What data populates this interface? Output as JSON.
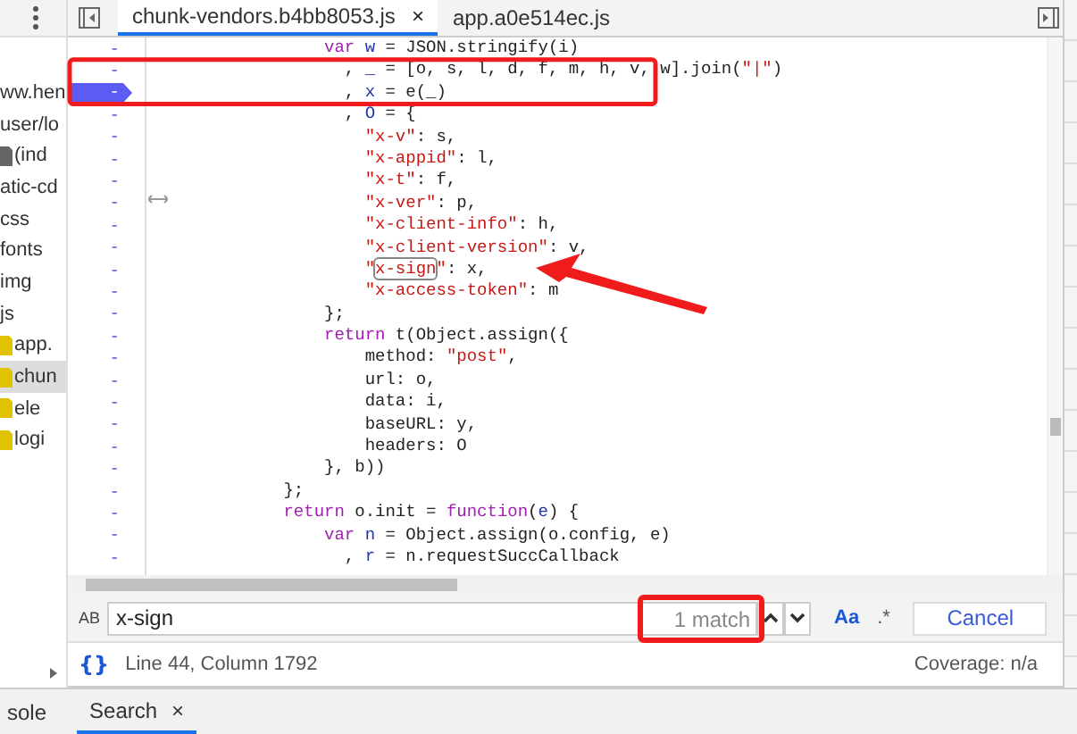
{
  "sidebar": {
    "items": [
      {
        "label": "ww.hen",
        "kind": "folder",
        "selected": false
      },
      {
        "label": "user/lo",
        "kind": "folder",
        "selected": false
      },
      {
        "label": "(ind",
        "kind": "file",
        "selected": false
      },
      {
        "label": "atic-cd",
        "kind": "folder",
        "selected": false
      },
      {
        "label": "css",
        "kind": "folder",
        "selected": false
      },
      {
        "label": "fonts",
        "kind": "folder",
        "selected": false
      },
      {
        "label": "img",
        "kind": "folder",
        "selected": false
      },
      {
        "label": "js",
        "kind": "folder",
        "selected": false
      },
      {
        "label": "app.",
        "kind": "script",
        "selected": false
      },
      {
        "label": "chun",
        "kind": "script",
        "selected": true
      },
      {
        "label": "ele",
        "kind": "script",
        "selected": false
      },
      {
        "label": "logi",
        "kind": "script",
        "selected": false
      }
    ]
  },
  "tabs": [
    {
      "label": "chunk-vendors.b4bb8053.js",
      "selected": true,
      "close": "×"
    },
    {
      "label": "app.a0e514ec.js",
      "selected": false
    }
  ],
  "code": {
    "lines": [
      {
        "mark": "-",
        "breakpoint": false,
        "tokens": [
          {
            "kind": "keyword",
            "text": "               var"
          },
          {
            "kind": "def",
            "text": " w"
          },
          {
            "kind": "plain",
            "text": " = JSON.stringify(i)"
          }
        ]
      },
      {
        "mark": "-",
        "breakpoint": false,
        "tokens": [
          {
            "kind": "plain",
            "text": "                 , "
          },
          {
            "kind": "def",
            "text": "_"
          },
          {
            "kind": "plain",
            "text": " = [o, s, l, d, f, m, h, v, w].join("
          },
          {
            "kind": "string",
            "text": "\"|\""
          },
          {
            "kind": "plain",
            "text": ")"
          }
        ]
      },
      {
        "mark": "-",
        "breakpoint": true,
        "tokens": [
          {
            "kind": "plain",
            "text": "                 , "
          },
          {
            "kind": "def",
            "text": "x"
          },
          {
            "kind": "plain",
            "text": " = e(_)"
          }
        ]
      },
      {
        "mark": "-",
        "breakpoint": false,
        "tokens": [
          {
            "kind": "plain",
            "text": "                 , "
          },
          {
            "kind": "def",
            "text": "O"
          },
          {
            "kind": "plain",
            "text": " = {"
          }
        ]
      },
      {
        "mark": "-",
        "breakpoint": false,
        "tokens": [
          {
            "kind": "string",
            "text": "                   \"x-v\""
          },
          {
            "kind": "plain",
            "text": ": s,"
          }
        ]
      },
      {
        "mark": "-",
        "breakpoint": false,
        "tokens": [
          {
            "kind": "string",
            "text": "                   \"x-appid\""
          },
          {
            "kind": "plain",
            "text": ": l,"
          }
        ]
      },
      {
        "mark": "-",
        "breakpoint": false,
        "tokens": [
          {
            "kind": "string",
            "text": "                   \"x-t\""
          },
          {
            "kind": "plain",
            "text": ": f,"
          }
        ]
      },
      {
        "mark": "-",
        "breakpoint": false,
        "tokens": [
          {
            "kind": "string",
            "text": "                   \"x-ver\""
          },
          {
            "kind": "plain",
            "text": ": p,"
          }
        ]
      },
      {
        "mark": "-",
        "breakpoint": false,
        "tokens": [
          {
            "kind": "string",
            "text": "                   \"x-client-info\""
          },
          {
            "kind": "plain",
            "text": ": h,"
          }
        ]
      },
      {
        "mark": "-",
        "breakpoint": false,
        "tokens": [
          {
            "kind": "string",
            "text": "                   \"x-client-version\""
          },
          {
            "kind": "plain",
            "text": ": v,"
          }
        ]
      },
      {
        "mark": "-",
        "breakpoint": false,
        "tokens": [
          {
            "kind": "string",
            "text": "                   \""
          },
          {
            "kind": "match",
            "text": "x-sign"
          },
          {
            "kind": "string",
            "text": "\""
          },
          {
            "kind": "plain",
            "text": ": x,"
          }
        ]
      },
      {
        "mark": "-",
        "breakpoint": false,
        "tokens": [
          {
            "kind": "string",
            "text": "                   \"x-access-token\""
          },
          {
            "kind": "plain",
            "text": ": m"
          }
        ]
      },
      {
        "mark": "-",
        "breakpoint": false,
        "tokens": [
          {
            "kind": "plain",
            "text": "               };"
          }
        ]
      },
      {
        "mark": "-",
        "breakpoint": false,
        "tokens": [
          {
            "kind": "keyword",
            "text": "               return"
          },
          {
            "kind": "plain",
            "text": " t(Object.assign({"
          }
        ]
      },
      {
        "mark": "-",
        "breakpoint": false,
        "tokens": [
          {
            "kind": "plain",
            "text": "                   method: "
          },
          {
            "kind": "string",
            "text": "\"post\""
          },
          {
            "kind": "plain",
            "text": ","
          }
        ]
      },
      {
        "mark": "-",
        "breakpoint": false,
        "tokens": [
          {
            "kind": "plain",
            "text": "                   url: o,"
          }
        ]
      },
      {
        "mark": "-",
        "breakpoint": false,
        "tokens": [
          {
            "kind": "plain",
            "text": "                   data: i,"
          }
        ]
      },
      {
        "mark": "-",
        "breakpoint": false,
        "tokens": [
          {
            "kind": "plain",
            "text": "                   baseURL: y,"
          }
        ]
      },
      {
        "mark": "-",
        "breakpoint": false,
        "tokens": [
          {
            "kind": "plain",
            "text": "                   headers: O"
          }
        ]
      },
      {
        "mark": "-",
        "breakpoint": false,
        "tokens": [
          {
            "kind": "plain",
            "text": "               }, b))"
          }
        ]
      },
      {
        "mark": "-",
        "breakpoint": false,
        "tokens": [
          {
            "kind": "plain",
            "text": "           };"
          }
        ]
      },
      {
        "mark": "-",
        "breakpoint": false,
        "tokens": [
          {
            "kind": "keyword",
            "text": "           return"
          },
          {
            "kind": "plain",
            "text": " o.init = "
          },
          {
            "kind": "keyword",
            "text": "function"
          },
          {
            "kind": "plain",
            "text": "("
          },
          {
            "kind": "def",
            "text": "e"
          },
          {
            "kind": "plain",
            "text": ") {"
          }
        ]
      },
      {
        "mark": "-",
        "breakpoint": false,
        "tokens": [
          {
            "kind": "keyword",
            "text": "               var"
          },
          {
            "kind": "def",
            "text": " n"
          },
          {
            "kind": "plain",
            "text": " = Object.assign(o.config, e)"
          }
        ]
      },
      {
        "mark": "-",
        "breakpoint": false,
        "tokens": [
          {
            "kind": "plain",
            "text": "                 , "
          },
          {
            "kind": "def",
            "text": "r"
          },
          {
            "kind": "plain",
            "text": " = n.requestSuccCallback"
          }
        ]
      }
    ]
  },
  "search": {
    "replace_toggle": "AB",
    "value": "x-sign",
    "count": "1 match",
    "case_toggle": "Aa",
    "regex_toggle": ".*",
    "cancel": "Cancel"
  },
  "status_bar": {
    "format_icon": "{}",
    "position": "Line 44, Column 1792",
    "coverage": "Coverage: n/a"
  },
  "drawer_tabs": [
    {
      "label": "sole",
      "selected": false
    },
    {
      "label": "Search",
      "selected": true,
      "close": "×"
    }
  ]
}
